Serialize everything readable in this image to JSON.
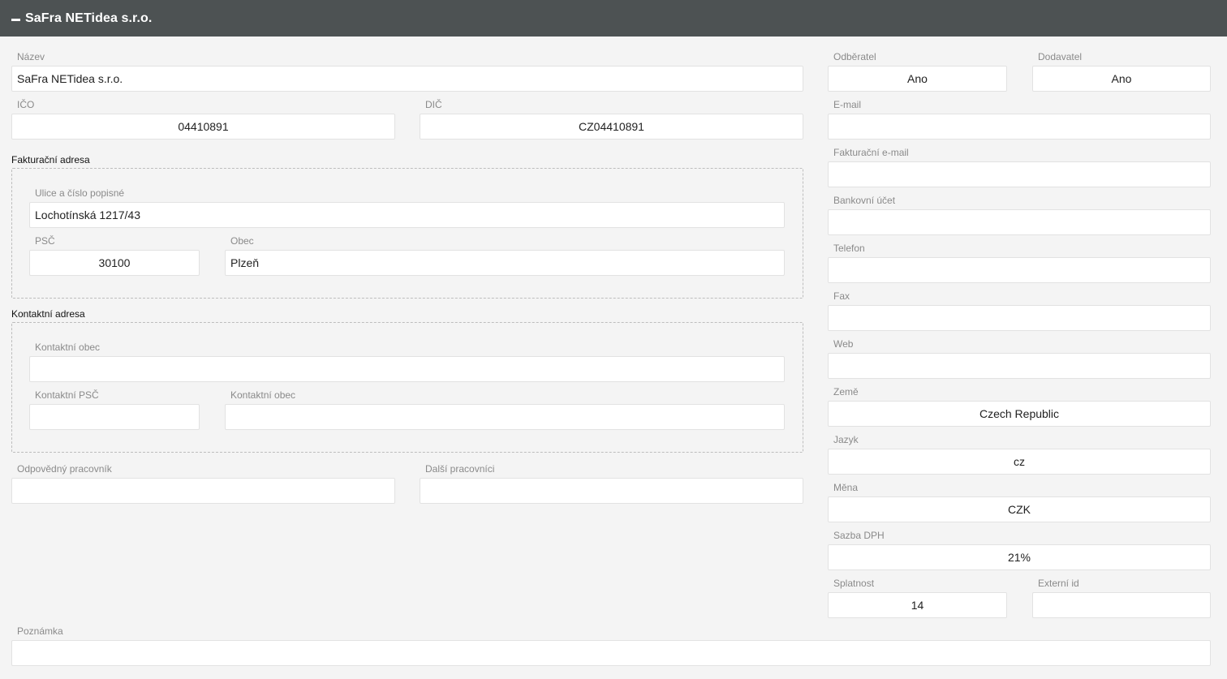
{
  "header": {
    "title": "SaFra NETidea s.r.o.",
    "collapse_icon": "minus-icon"
  },
  "left": {
    "nazev": {
      "label": "Název",
      "value": "SaFra NETidea s.r.o."
    },
    "ico": {
      "label": "IČO",
      "value": "04410891"
    },
    "dic": {
      "label": "DIČ",
      "value": "CZ04410891"
    },
    "fakturacni_adresa": {
      "title": "Fakturační adresa",
      "ulice": {
        "label": "Ulice a číslo popisné",
        "value": "Lochotínská 1217/43"
      },
      "psc": {
        "label": "PSČ",
        "value": "30100"
      },
      "obec": {
        "label": "Obec",
        "value": "Plzeň"
      }
    },
    "kontaktni_adresa": {
      "title": "Kontaktní adresa",
      "obec_top": {
        "label": "Kontaktní obec",
        "value": ""
      },
      "psc": {
        "label": "Kontaktní PSČ",
        "value": ""
      },
      "obec": {
        "label": "Kontaktní obec",
        "value": ""
      }
    },
    "odpovedny": {
      "label": "Odpovědný pracovník",
      "value": ""
    },
    "dalsi": {
      "label": "Další pracovníci",
      "value": ""
    }
  },
  "right": {
    "odberatel": {
      "label": "Odběratel",
      "value": "Ano"
    },
    "dodavatel": {
      "label": "Dodavatel",
      "value": "Ano"
    },
    "email": {
      "label": "E-mail",
      "value": ""
    },
    "fakturacni_email": {
      "label": "Fakturační e-mail",
      "value": ""
    },
    "bankovni_ucet": {
      "label": "Bankovní účet",
      "value": ""
    },
    "telefon": {
      "label": "Telefon",
      "value": ""
    },
    "fax": {
      "label": "Fax",
      "value": ""
    },
    "web": {
      "label": "Web",
      "value": ""
    },
    "zeme": {
      "label": "Země",
      "value": "Czech Republic"
    },
    "jazyk": {
      "label": "Jazyk",
      "value": "cz"
    },
    "mena": {
      "label": "Měna",
      "value": "CZK"
    },
    "sazba_dph": {
      "label": "Sazba DPH",
      "value": "21%"
    },
    "splatnost": {
      "label": "Splatnost",
      "value": "14"
    },
    "externi_id": {
      "label": "Externí id",
      "value": ""
    }
  },
  "poznamka": {
    "label": "Poznámka",
    "value": ""
  }
}
